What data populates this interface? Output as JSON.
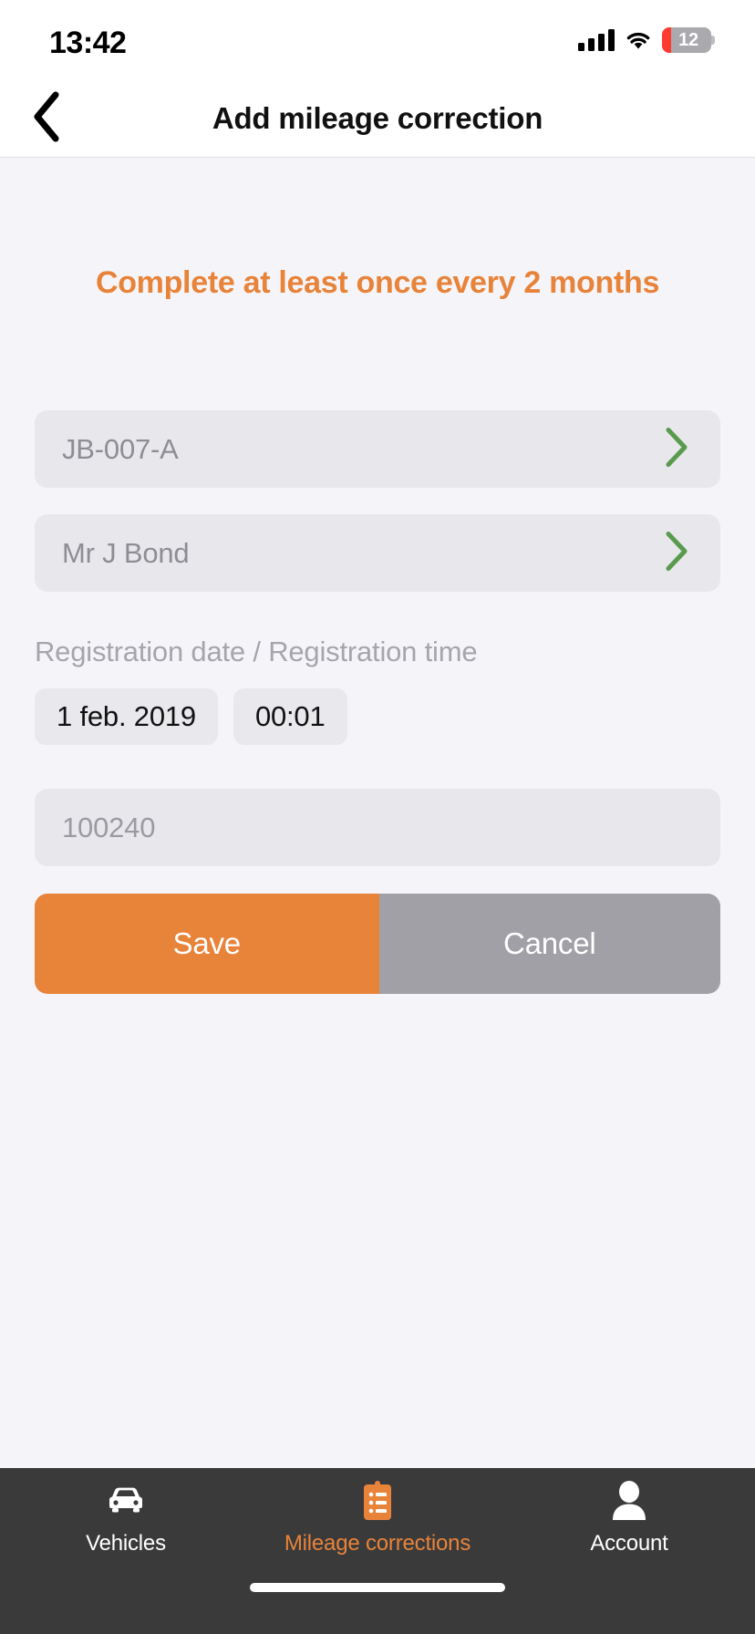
{
  "status_bar": {
    "time": "13:42",
    "battery_percent": "12",
    "cellular_icon": "cellular-bars-icon",
    "wifi_icon": "wifi-icon",
    "battery_icon": "battery-low-icon"
  },
  "nav": {
    "back_icon": "chevron-left-icon",
    "title": "Add mileage correction"
  },
  "banner": {
    "text": "Complete at least once every 2 months",
    "color": "#e8833a"
  },
  "form": {
    "vehicle": {
      "value": "JB-007-A",
      "chevron_icon": "chevron-right-icon",
      "chevron_color": "#5a9a4e"
    },
    "driver": {
      "value": "Mr J Bond",
      "chevron_icon": "chevron-right-icon",
      "chevron_color": "#5a9a4e"
    },
    "datetime_label": "Registration date / Registration time",
    "date_value": "1 feb. 2019",
    "time_value": "00:01",
    "mileage_placeholder": "100240"
  },
  "actions": {
    "save_label": "Save",
    "save_color": "#e8833a",
    "cancel_label": "Cancel",
    "cancel_color": "#a0a0a6"
  },
  "tabbar": {
    "items": [
      {
        "label": "Vehicles",
        "icon": "car-icon",
        "active": false
      },
      {
        "label": "Mileage corrections",
        "icon": "clipboard-list-icon",
        "active": true
      },
      {
        "label": "Account",
        "icon": "person-icon",
        "active": false
      }
    ],
    "active_color": "#e8833a",
    "inactive_color": "#ffffff",
    "background": "#3a3a3a"
  }
}
